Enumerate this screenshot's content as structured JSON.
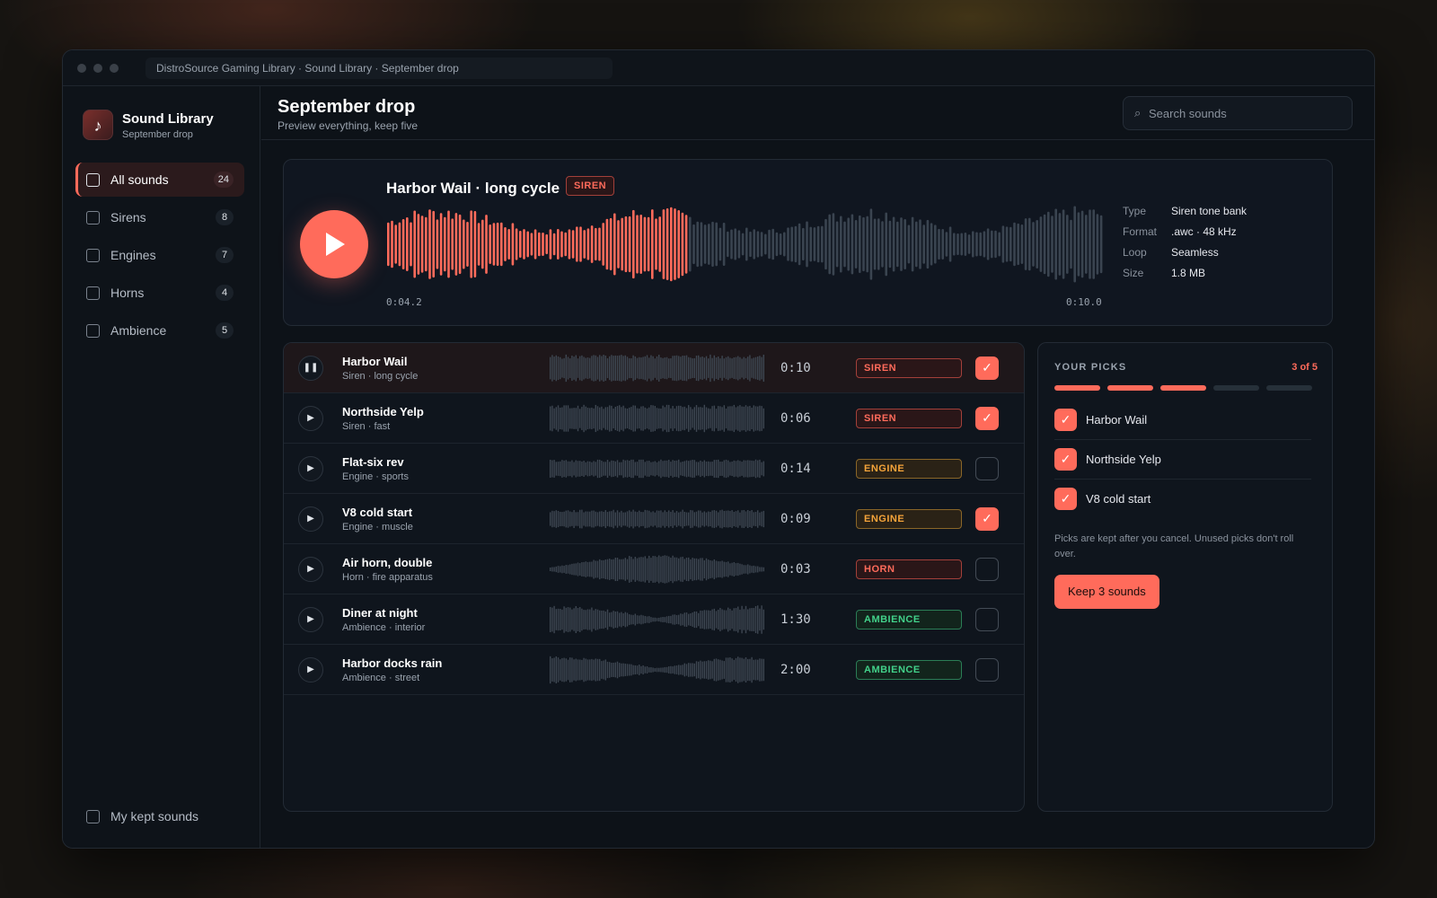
{
  "window": {
    "breadcrumb": "DistroSource Gaming Library · Sound Library · September drop"
  },
  "sidebar": {
    "brand_title": "Sound Library",
    "brand_subtitle": "September drop",
    "brand_icon": "music-note-icon",
    "items": [
      {
        "label": "All sounds",
        "count": "24",
        "active": true
      },
      {
        "label": "Sirens",
        "count": "8"
      },
      {
        "label": "Engines",
        "count": "7"
      },
      {
        "label": "Horns",
        "count": "4"
      },
      {
        "label": "Ambience",
        "count": "5"
      }
    ],
    "kept_label": "My kept sounds"
  },
  "header": {
    "title": "September drop",
    "subtitle": "Preview everything, keep five",
    "search_placeholder": "Search sounds",
    "search_icon": "search-icon"
  },
  "player": {
    "title": "Harbor Wail · long cycle",
    "tag": "SIREN",
    "elapsed": "0:04.2",
    "total": "0:10.0",
    "progress": 0.42,
    "meta": [
      {
        "key": "Type",
        "value": "Siren tone bank"
      },
      {
        "key": "Format",
        "value": ".awc · 48 kHz"
      },
      {
        "key": "Loop",
        "value": "Seamless"
      },
      {
        "key": "Size",
        "value": "1.8 MB"
      }
    ]
  },
  "sounds": [
    {
      "name": "Harbor Wail",
      "sub": "Siren · long cycle",
      "duration": "0:10",
      "tag": "SIREN",
      "tag_type": "siren",
      "checked": true,
      "playing": true,
      "wave": "dense"
    },
    {
      "name": "Northside Yelp",
      "sub": "Siren · fast",
      "duration": "0:06",
      "tag": "SIREN",
      "tag_type": "siren",
      "checked": true,
      "wave": "dense"
    },
    {
      "name": "Flat-six rev",
      "sub": "Engine · sports",
      "duration": "0:14",
      "tag": "ENGINE",
      "tag_type": "engine",
      "checked": false,
      "wave": "flat"
    },
    {
      "name": "V8 cold start",
      "sub": "Engine · muscle",
      "duration": "0:09",
      "tag": "ENGINE",
      "tag_type": "engine",
      "checked": true,
      "wave": "flat"
    },
    {
      "name": "Air horn, double",
      "sub": "Horn · fire apparatus",
      "duration": "0:03",
      "tag": "HORN",
      "tag_type": "horn",
      "checked": false,
      "wave": "bell"
    },
    {
      "name": "Diner at night",
      "sub": "Ambience · interior",
      "duration": "1:30",
      "tag": "AMBIENCE",
      "tag_type": "ambience",
      "checked": false,
      "wave": "dip"
    },
    {
      "name": "Harbor docks rain",
      "sub": "Ambience · street",
      "duration": "2:00",
      "tag": "AMBIENCE",
      "tag_type": "ambience",
      "checked": false,
      "wave": "dip"
    }
  ],
  "picks": {
    "title": "YOUR PICKS",
    "count_label": "3 of 5",
    "filled": 3,
    "total": 5,
    "items": [
      "Harbor Wail",
      "Northside Yelp",
      "V8 cold start"
    ],
    "note": "Picks are kept after you cancel. Unused picks don't roll over.",
    "button_label": "Keep 3 sounds"
  },
  "colors": {
    "accent": "#ff6b5b",
    "siren": "#ff6b5b",
    "engine": "#f5a43a",
    "ambience": "#42d18a",
    "wave_idle": "#3a4450"
  }
}
